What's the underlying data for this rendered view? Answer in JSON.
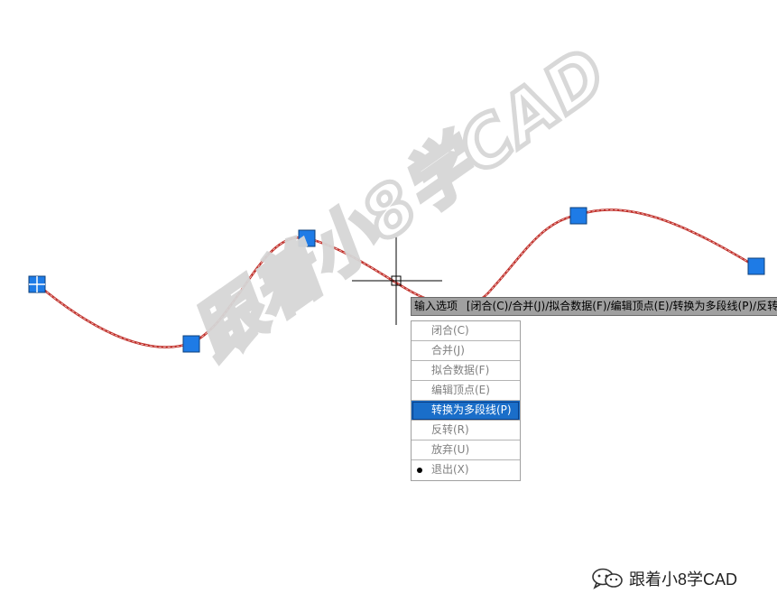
{
  "watermark": {
    "text": "跟着小8学CAD"
  },
  "command_prompt": {
    "prefix": "输入选项",
    "options": "[闭合(C)/合并(J)/拟合数据(F)/编辑顶点(E)/转换为多段线(P)/反转(R)/放弃(U)]"
  },
  "context_menu": {
    "items": [
      {
        "label": "闭合(C)",
        "selected": false,
        "bullet": false
      },
      {
        "label": "合并(J)",
        "selected": false,
        "bullet": false
      },
      {
        "label": "拟合数据(F)",
        "selected": false,
        "bullet": false
      },
      {
        "label": "编辑顶点(E)",
        "selected": false,
        "bullet": false
      },
      {
        "label": "转换为多段线(P)",
        "selected": true,
        "bullet": false
      },
      {
        "label": "反转(R)",
        "selected": false,
        "bullet": false
      },
      {
        "label": "放弃(U)",
        "selected": false,
        "bullet": false
      },
      {
        "label": "退出(X)",
        "selected": false,
        "bullet": true
      }
    ]
  },
  "brand": {
    "name": "跟着小8学CAD"
  },
  "colors": {
    "spline_stroke": "#c0302a",
    "grip_fill": "#1e7be6",
    "grip_border": "#0d3f7a",
    "crosshair": "#000000",
    "menu_highlight": "#1a6ec9"
  }
}
